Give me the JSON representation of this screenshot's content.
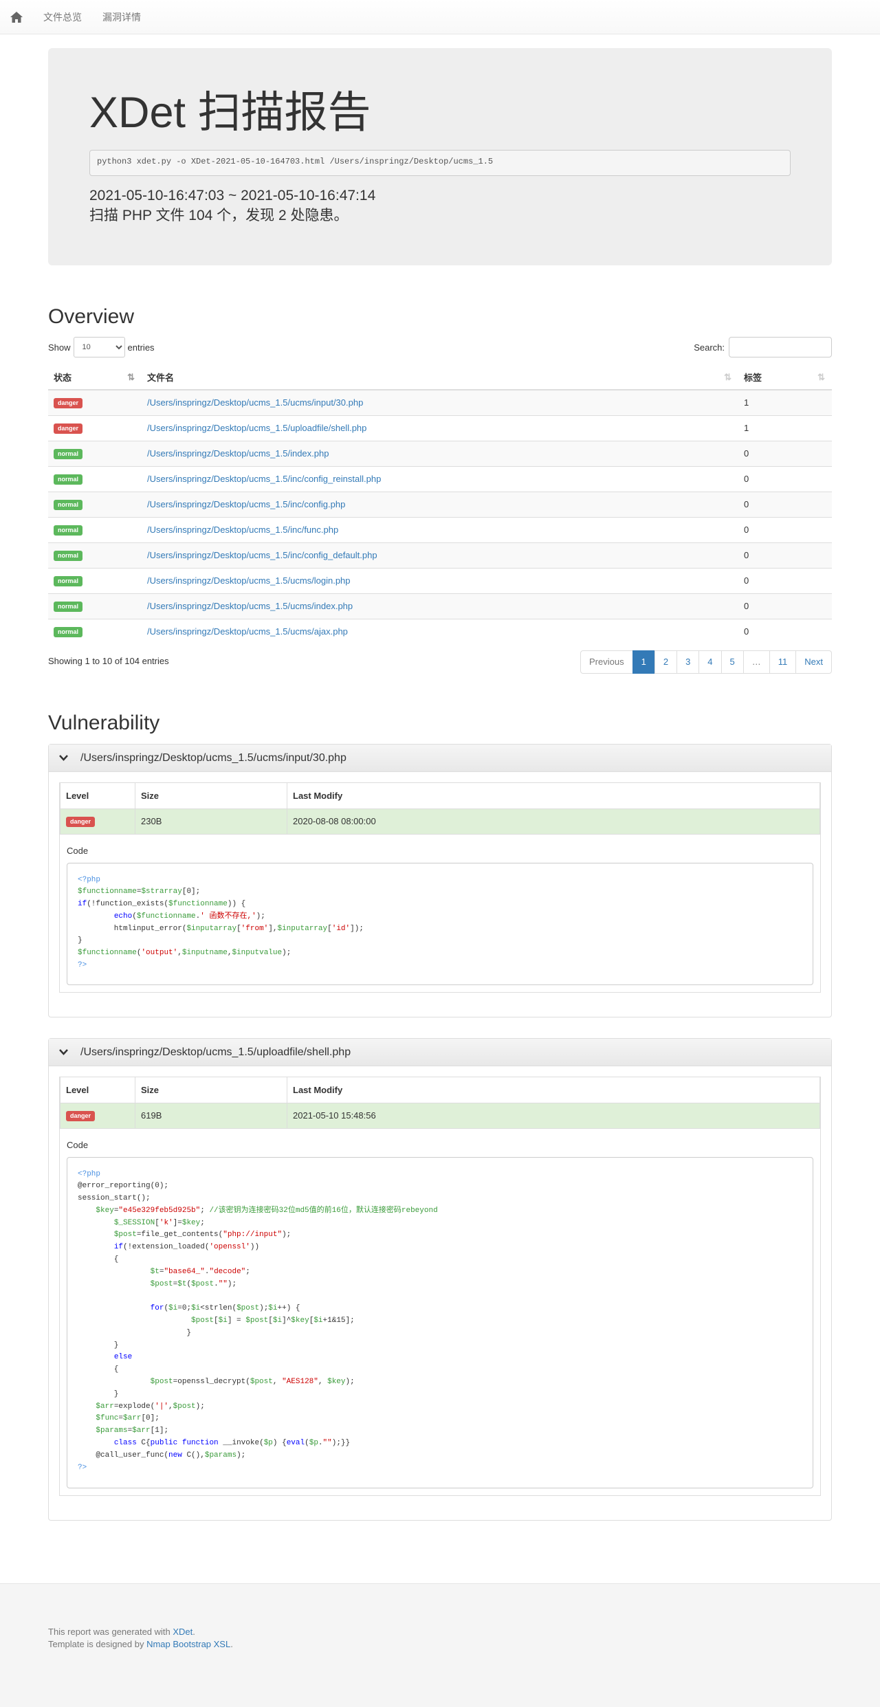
{
  "nav": {
    "items": [
      "文件总览",
      "漏洞详情"
    ]
  },
  "header": {
    "title": "XDet 扫描报告",
    "command": "python3 xdet.py -o XDet-2021-05-10-164703.html /Users/inspringz/Desktop/ucms_1.5",
    "time_range": "2021-05-10-16:47:03 ~ 2021-05-10-16:47:14",
    "summary": "扫描 PHP 文件 104 个，发现 2 处隐患。"
  },
  "overview": {
    "heading": "Overview",
    "show_label": "Show",
    "entries_value": "10",
    "entries_label": "entries",
    "search_label": "Search:",
    "columns": [
      "状态",
      "文件名",
      "标签"
    ],
    "rows": [
      {
        "status": "danger",
        "file": "/Users/inspringz/Desktop/ucms_1.5/ucms/input/30.php",
        "tag": "1"
      },
      {
        "status": "danger",
        "file": "/Users/inspringz/Desktop/ucms_1.5/uploadfile/shell.php",
        "tag": "1"
      },
      {
        "status": "normal",
        "file": "/Users/inspringz/Desktop/ucms_1.5/index.php",
        "tag": "0"
      },
      {
        "status": "normal",
        "file": "/Users/inspringz/Desktop/ucms_1.5/inc/config_reinstall.php",
        "tag": "0"
      },
      {
        "status": "normal",
        "file": "/Users/inspringz/Desktop/ucms_1.5/inc/config.php",
        "tag": "0"
      },
      {
        "status": "normal",
        "file": "/Users/inspringz/Desktop/ucms_1.5/inc/func.php",
        "tag": "0"
      },
      {
        "status": "normal",
        "file": "/Users/inspringz/Desktop/ucms_1.5/inc/config_default.php",
        "tag": "0"
      },
      {
        "status": "normal",
        "file": "/Users/inspringz/Desktop/ucms_1.5/ucms/login.php",
        "tag": "0"
      },
      {
        "status": "normal",
        "file": "/Users/inspringz/Desktop/ucms_1.5/ucms/index.php",
        "tag": "0"
      },
      {
        "status": "normal",
        "file": "/Users/inspringz/Desktop/ucms_1.5/ucms/ajax.php",
        "tag": "0"
      }
    ],
    "showing": "Showing 1 to 10 of 104 entries",
    "pagination": [
      "Previous",
      "1",
      "2",
      "3",
      "4",
      "5",
      "…",
      "11",
      "Next"
    ],
    "active_page": "1"
  },
  "vulnerability": {
    "heading": "Vulnerability",
    "columns": [
      "Level",
      "Size",
      "Last Modify"
    ],
    "code_label": "Code",
    "items": [
      {
        "file": "/Users/inspringz/Desktop/ucms_1.5/ucms/input/30.php",
        "level": "danger",
        "size": "230B",
        "modified": "2020-08-08 08:00:00"
      },
      {
        "file": "/Users/inspringz/Desktop/ucms_1.5/uploadfile/shell.php",
        "level": "danger",
        "size": "619B",
        "modified": "2021-05-10 15:48:56"
      }
    ]
  },
  "footer": {
    "line1_prefix": "This report was generated with ",
    "line1_link": "XDet",
    "line2_prefix": "Template is designed by ",
    "line2_link": "Nmap Bootstrap XSL"
  },
  "colors": {
    "danger": "#d9534f",
    "normal": "#5cb85c",
    "link": "#337ab7",
    "row_highlight": "#dff0d8"
  }
}
